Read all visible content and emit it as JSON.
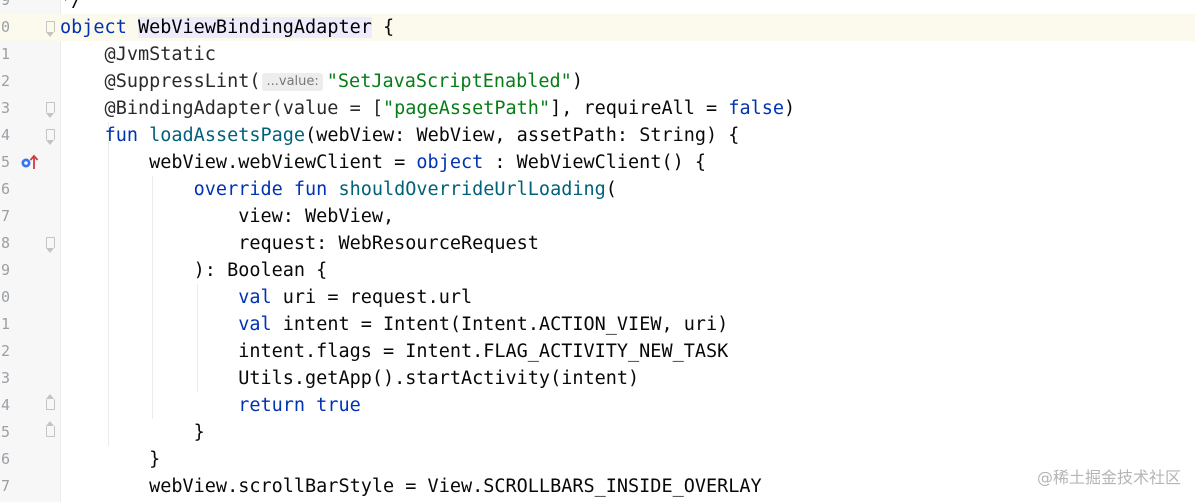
{
  "editor": {
    "lines": [
      {
        "number": "9",
        "tokens": [
          {
            "t": "*/",
            "c": "plain"
          }
        ]
      },
      {
        "number": "0",
        "tokens": [
          {
            "t": "object",
            "c": "kw"
          },
          {
            "t": " ",
            "c": "plain"
          },
          {
            "t": "WebViewBindingAdapter",
            "c": "hl"
          },
          {
            "t": " {",
            "c": "plain"
          }
        ]
      },
      {
        "number": "1",
        "tokens": [
          {
            "t": "    @JvmStatic",
            "c": "ann"
          }
        ]
      },
      {
        "number": "2",
        "tokens": [
          {
            "t": "    @SuppressLint(",
            "c": "ann"
          },
          {
            "t": "...value:",
            "c": "hint"
          },
          {
            "t": "\"SetJavaScriptEnabled\"",
            "c": "str"
          },
          {
            "t": ")",
            "c": "plain"
          }
        ]
      },
      {
        "number": "3",
        "tokens": [
          {
            "t": "    @BindingAdapter(value = [",
            "c": "ann"
          },
          {
            "t": "\"pageAssetPath\"",
            "c": "str"
          },
          {
            "t": "], requireAll = ",
            "c": "plain"
          },
          {
            "t": "false",
            "c": "kw"
          },
          {
            "t": ")",
            "c": "plain"
          }
        ]
      },
      {
        "number": "4",
        "tokens": [
          {
            "t": "    ",
            "c": "plain"
          },
          {
            "t": "fun",
            "c": "kw"
          },
          {
            "t": " ",
            "c": "plain"
          },
          {
            "t": "loadAssetsPage",
            "c": "fn"
          },
          {
            "t": "(webView: WebView, assetPath: String) {",
            "c": "plain"
          }
        ]
      },
      {
        "number": "5",
        "tokens": [
          {
            "t": "        webView.webViewClient = ",
            "c": "plain"
          },
          {
            "t": "object",
            "c": "kw"
          },
          {
            "t": " : WebViewClient() {",
            "c": "plain"
          }
        ]
      },
      {
        "number": "6",
        "tokens": [
          {
            "t": "            ",
            "c": "plain"
          },
          {
            "t": "override fun",
            "c": "kw"
          },
          {
            "t": " ",
            "c": "plain"
          },
          {
            "t": "shouldOverrideUrlLoading",
            "c": "fn"
          },
          {
            "t": "(",
            "c": "plain"
          }
        ]
      },
      {
        "number": "7",
        "tokens": [
          {
            "t": "                view: WebView,",
            "c": "plain"
          }
        ]
      },
      {
        "number": "8",
        "tokens": [
          {
            "t": "                request: WebResourceRequest",
            "c": "plain"
          }
        ]
      },
      {
        "number": "9",
        "tokens": [
          {
            "t": "            ): Boolean {",
            "c": "plain"
          }
        ]
      },
      {
        "number": "0",
        "tokens": [
          {
            "t": "                ",
            "c": "plain"
          },
          {
            "t": "val",
            "c": "kw"
          },
          {
            "t": " uri = request.url",
            "c": "plain"
          }
        ]
      },
      {
        "number": "1",
        "tokens": [
          {
            "t": "                ",
            "c": "plain"
          },
          {
            "t": "val",
            "c": "kw"
          },
          {
            "t": " intent = Intent(Intent.ACTION_VIEW, uri)",
            "c": "plain"
          }
        ]
      },
      {
        "number": "2",
        "tokens": [
          {
            "t": "                intent.flags = Intent.FLAG_ACTIVITY_NEW_TASK",
            "c": "plain"
          }
        ]
      },
      {
        "number": "3",
        "tokens": [
          {
            "t": "                Utils.getApp().startActivity(intent)",
            "c": "plain"
          }
        ]
      },
      {
        "number": "4",
        "tokens": [
          {
            "t": "                ",
            "c": "plain"
          },
          {
            "t": "return true",
            "c": "kw"
          }
        ]
      },
      {
        "number": "5",
        "tokens": [
          {
            "t": "            }",
            "c": "plain"
          }
        ]
      },
      {
        "number": "6",
        "tokens": [
          {
            "t": "        }",
            "c": "plain"
          }
        ]
      },
      {
        "number": "7",
        "tokens": [
          {
            "t": "        webView.scrollBarStyle = View.SCROLLBARS_INSIDE_OVERLAY",
            "c": "plain"
          }
        ]
      }
    ],
    "current_line_index": 1,
    "fold_start_indices": [
      1,
      4,
      5,
      9
    ],
    "fold_end_indices": [
      15,
      16
    ],
    "override_marker_index": 6,
    "icons": {
      "override": "override-method-icon",
      "fold": "fold-marker-icon"
    },
    "colors": {
      "keyword": "#0033b3",
      "function": "#00627a",
      "string": "#067d17",
      "current_line": "#fcfaed"
    }
  },
  "watermark": "@稀土掘金技术社区"
}
